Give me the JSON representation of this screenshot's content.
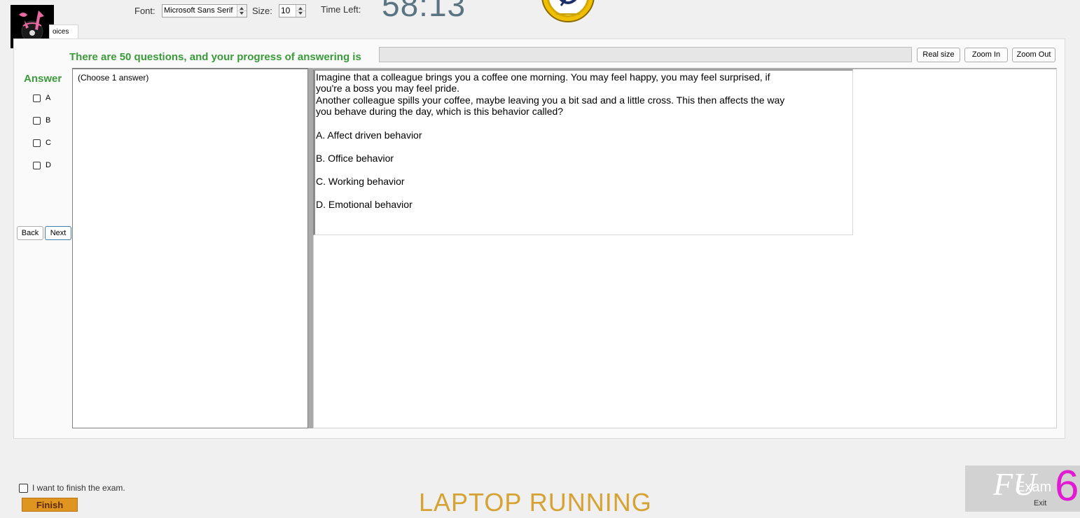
{
  "toolbar": {
    "font_label": "Font:",
    "font_value": "Microsoft Sans Serif",
    "size_label": "Size:",
    "size_value": "10",
    "time_left_label": "Time Left:",
    "time_left_value": "58:13"
  },
  "tab": {
    "label": "oices"
  },
  "progress": {
    "text": "There are 50 questions, and your progress of answering is",
    "fraction": 0
  },
  "zoom": {
    "real_size": "Real size",
    "zoom_in": "Zoom In",
    "zoom_out": "Zoom Out"
  },
  "answer": {
    "title": "Answer",
    "choices": [
      "A",
      "B",
      "C",
      "D"
    ]
  },
  "nav": {
    "back": "Back",
    "next": "Next"
  },
  "choose_hint": "(Choose 1 answer)",
  "question": {
    "lines": [
      "Imagine that a colleague brings you a coffee one morning. You may feel happy, you may feel surprised, if",
      "you're a boss you may feel pride.",
      "Another colleague spills your coffee, maybe leaving you a bit sad and a little cross. This then affects the way",
      "you behave during the day, which is this behavior called?"
    ],
    "options": [
      "A.  Affect driven behavior",
      "B.  Office behavior",
      "C.  Working behavior",
      "D.  Emotional behavior"
    ]
  },
  "footer": {
    "finish_check": "I want to finish the exam.",
    "finish_button": "Finish",
    "status_text": "LAPTOP RUNNING",
    "exam_word": "Exam",
    "exit_word": "Exit",
    "fu_mark": "FU",
    "version": "6"
  },
  "colors": {
    "accent_green": "#3a9a3a",
    "timer": "#5a7482",
    "finish": "#e09520",
    "status": "#d6a233",
    "six": "#e01bd1"
  }
}
